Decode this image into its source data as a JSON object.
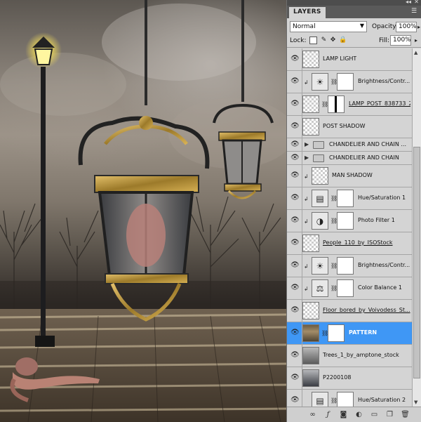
{
  "panel": {
    "title": "LAYERS",
    "blend_mode": "Normal",
    "opacity_label": "Opacity:",
    "opacity_value": "100%",
    "lock_label": "Lock:",
    "fill_label": "Fill:",
    "fill_value": "100%"
  },
  "layers": [
    {
      "name": "LAMP LIGHT",
      "kind": "pixel"
    },
    {
      "name": "Brightness/Contr...",
      "kind": "adjustment",
      "icon": "sun-icon",
      "clipped": true
    },
    {
      "name": "LAMP_POST_838733_2...",
      "kind": "masked",
      "underline": true
    },
    {
      "name": "POST SHADOW",
      "kind": "pixel"
    },
    {
      "name": "CHANDELIER AND CHAIN ...",
      "kind": "group"
    },
    {
      "name": "CHANDELIER AND CHAIN",
      "kind": "group"
    },
    {
      "name": "MAN SHADOW",
      "kind": "pixel",
      "clipped": true
    },
    {
      "name": "Hue/Saturation 1",
      "kind": "adjustment",
      "icon": "hue-saturation-icon",
      "clipped": true
    },
    {
      "name": "Photo Filter 1",
      "kind": "adjustment",
      "icon": "photo-filter-icon",
      "clipped": true
    },
    {
      "name": "People_110_by_ISOStock",
      "kind": "pixel",
      "underline": true
    },
    {
      "name": "Brightness/Contr...",
      "kind": "adjustment",
      "icon": "sun-icon",
      "clipped": true
    },
    {
      "name": "Color Balance 1",
      "kind": "adjustment",
      "icon": "scales-icon",
      "clipped": true
    },
    {
      "name": "Floor_bored_by_Voivodess_St...",
      "kind": "pixel",
      "underline": true
    },
    {
      "name": "PATTERN",
      "kind": "pattern",
      "selected": true
    },
    {
      "name": "Trees_1_by_amptone_stock",
      "kind": "trees"
    },
    {
      "name": "P2200108",
      "kind": "photo"
    },
    {
      "name": "Hue/Saturation 2",
      "kind": "adjustment",
      "icon": "hue-saturation-icon"
    }
  ],
  "colors": {
    "selection": "#3f97f5",
    "panel_bg": "#d4d4d4"
  }
}
